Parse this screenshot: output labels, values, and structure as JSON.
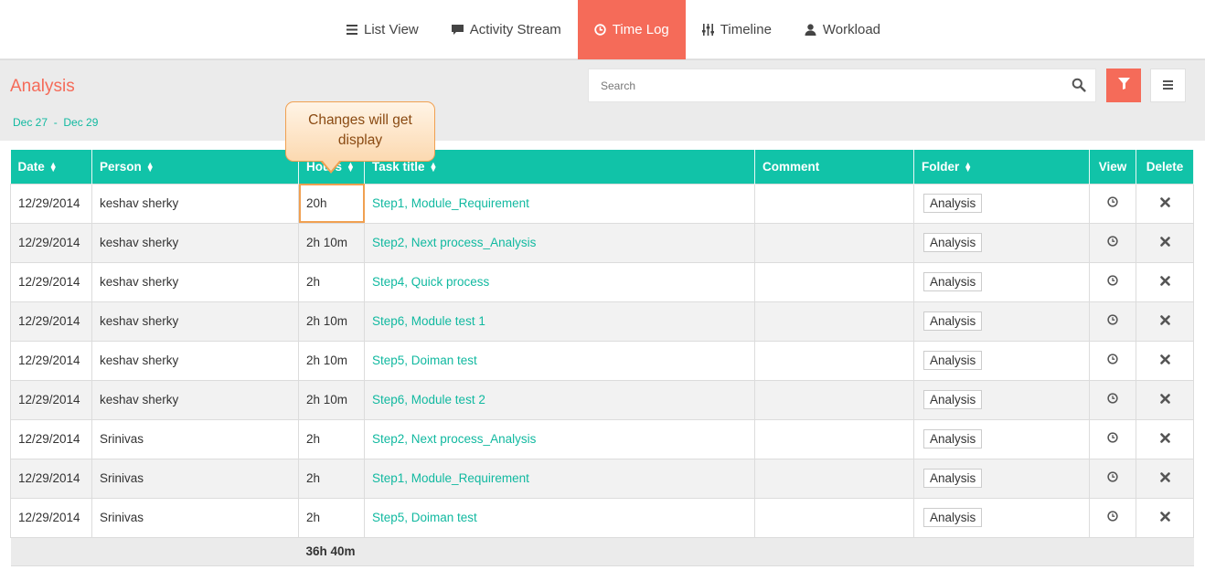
{
  "nav": {
    "tabs": [
      {
        "label": "List View",
        "icon": "list-icon"
      },
      {
        "label": "Activity Stream",
        "icon": "comment-icon"
      },
      {
        "label": "Time Log",
        "icon": "clock-icon",
        "active": true
      },
      {
        "label": "Timeline",
        "icon": "sliders-icon"
      },
      {
        "label": "Workload",
        "icon": "user-icon"
      }
    ]
  },
  "header": {
    "title": "Analysis",
    "date_start": "Dec 27",
    "date_sep": "-",
    "date_end": "Dec 29"
  },
  "search": {
    "placeholder": "Search"
  },
  "colors": {
    "accent": "#f56b59",
    "teal": "#11c3a8",
    "callout_border": "#f0a051"
  },
  "table": {
    "headers": {
      "date": "Date",
      "person": "Person",
      "hours": "Hours",
      "task": "Task title",
      "comment": "Comment",
      "folder": "Folder",
      "view": "View",
      "delete": "Delete"
    },
    "rows": [
      {
        "date": "12/29/2014",
        "person": "keshav sherky",
        "hours": "20h",
        "task": "Step1, Module_Requirement",
        "comment": "",
        "folder": "Analysis"
      },
      {
        "date": "12/29/2014",
        "person": "keshav sherky",
        "hours": "2h 10m",
        "task": "Step2, Next process_Analysis",
        "comment": "",
        "folder": "Analysis"
      },
      {
        "date": "12/29/2014",
        "person": "keshav sherky",
        "hours": "2h",
        "task": "Step4, Quick process",
        "comment": "",
        "folder": "Analysis"
      },
      {
        "date": "12/29/2014",
        "person": "keshav sherky",
        "hours": "2h 10m",
        "task": "Step6, Module test 1",
        "comment": "",
        "folder": "Analysis"
      },
      {
        "date": "12/29/2014",
        "person": "keshav sherky",
        "hours": "2h 10m",
        "task": "Step5, Doiman test",
        "comment": "",
        "folder": "Analysis"
      },
      {
        "date": "12/29/2014",
        "person": "keshav sherky",
        "hours": "2h 10m",
        "task": "Step6, Module test 2",
        "comment": "",
        "folder": "Analysis"
      },
      {
        "date": "12/29/2014",
        "person": "Srinivas",
        "hours": "2h",
        "task": "Step2, Next process_Analysis",
        "comment": "",
        "folder": "Analysis"
      },
      {
        "date": "12/29/2014",
        "person": "Srinivas",
        "hours": "2h",
        "task": "Step1, Module_Requirement",
        "comment": "",
        "folder": "Analysis"
      },
      {
        "date": "12/29/2014",
        "person": "Srinivas",
        "hours": "2h",
        "task": "Step5, Doiman test",
        "comment": "",
        "folder": "Analysis"
      }
    ],
    "total_hours": "36h 40m"
  },
  "callout": {
    "text": "Changes will get display"
  }
}
